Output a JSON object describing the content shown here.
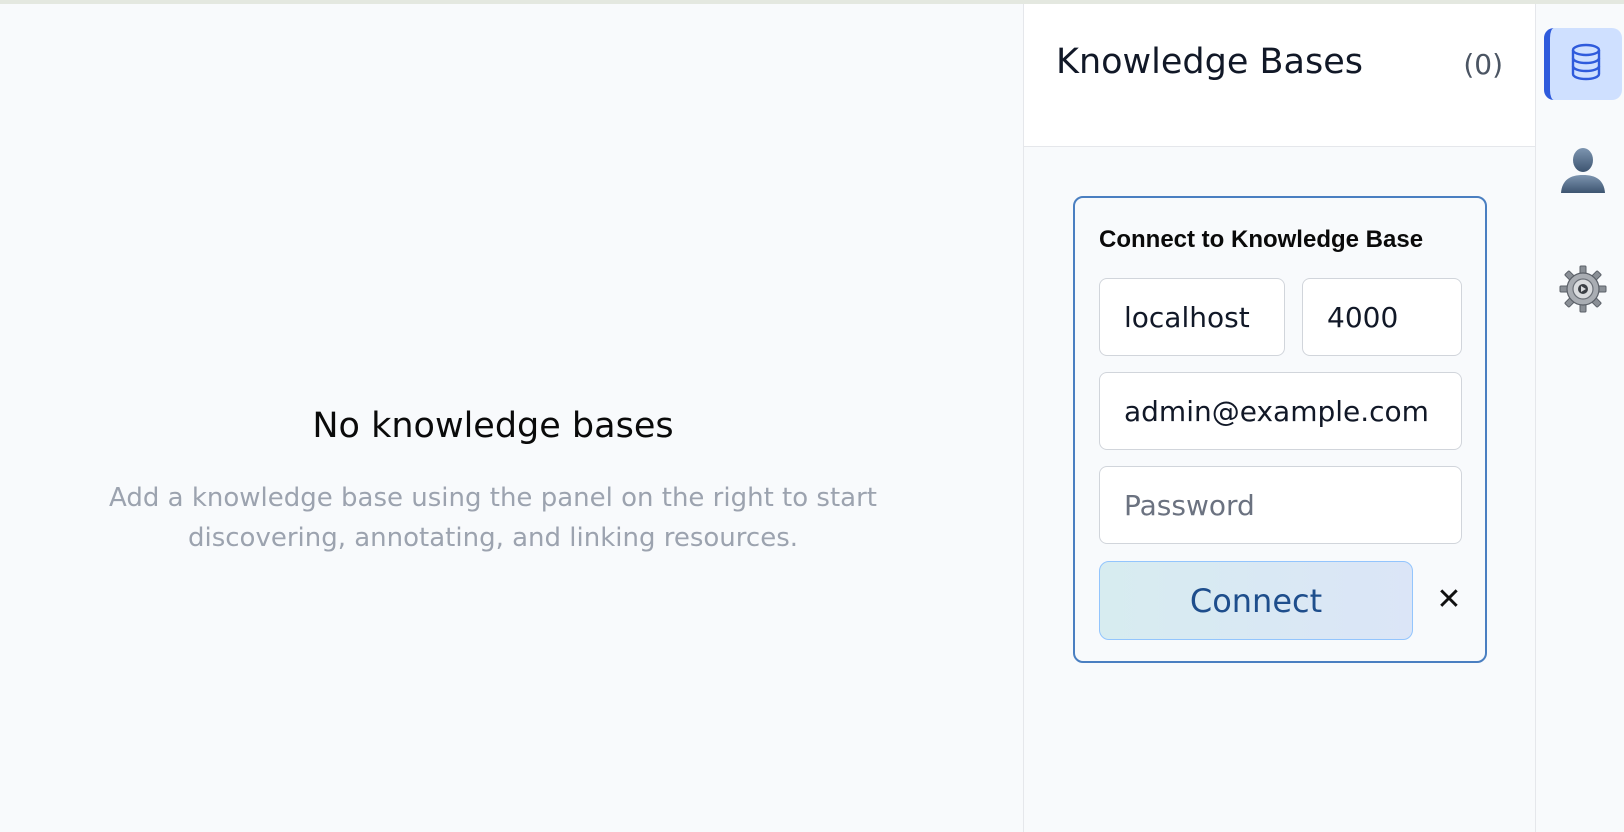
{
  "empty_state": {
    "title": "No knowledge bases",
    "description": "Add a knowledge base using the panel on the right to start discovering, annotating, and linking resources."
  },
  "panel": {
    "title": "Knowledge Bases",
    "count": "(0)"
  },
  "connect_form": {
    "title": "Connect to Knowledge Base",
    "host_value": "localhost",
    "port_value": "4000",
    "email_value": "admin@example.com",
    "password_placeholder": "Password",
    "connect_label": "Connect",
    "close_label": "✕"
  },
  "rail": {
    "items": [
      {
        "icon": "database-icon",
        "active": true
      },
      {
        "icon": "user-icon",
        "active": false
      },
      {
        "icon": "gear-icon",
        "active": false
      }
    ]
  },
  "colors": {
    "accent": "#2f5bdc",
    "card_border": "#4a7fc1",
    "connect_text": "#1e4e8c"
  }
}
